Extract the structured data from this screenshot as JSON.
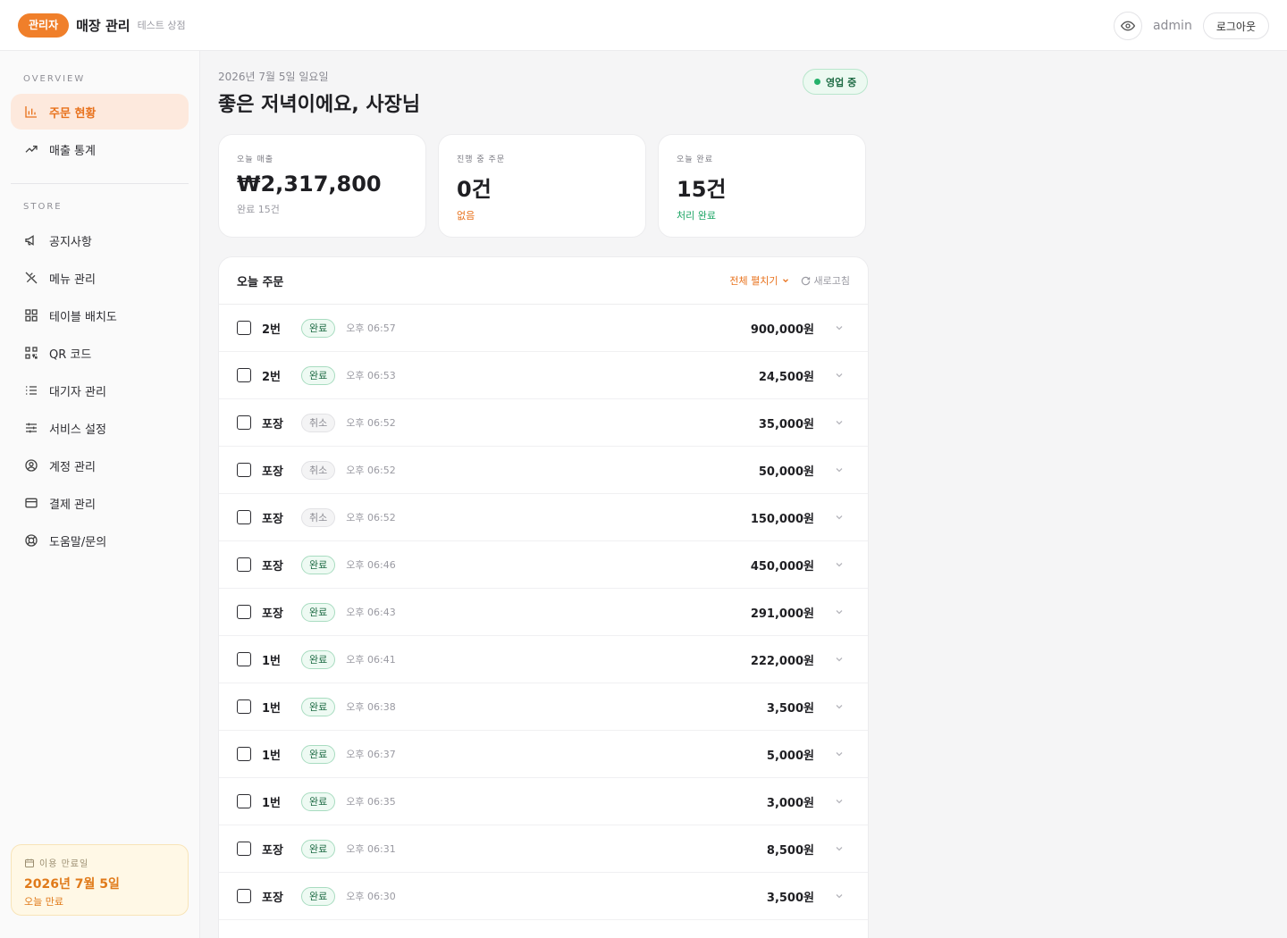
{
  "header": {
    "role_badge": "관리자",
    "title": "매장 관리",
    "store_name": "테스트 상점",
    "user": "admin",
    "logout_label": "로그아웃"
  },
  "sidebar": {
    "sections": [
      {
        "title": "OVERVIEW",
        "items": [
          {
            "label": "주문 현황",
            "icon": "bar-chart-icon",
            "active": true
          },
          {
            "label": "매출 통계",
            "icon": "trend-up-icon",
            "active": false
          }
        ]
      },
      {
        "title": "STORE",
        "items": [
          {
            "label": "공지사항",
            "icon": "megaphone-icon"
          },
          {
            "label": "메뉴 관리",
            "icon": "utensils-icon"
          },
          {
            "label": "테이블 배치도",
            "icon": "grid-icon"
          },
          {
            "label": "QR 코드",
            "icon": "qr-code-icon"
          },
          {
            "label": "대기자 관리",
            "icon": "list-icon"
          },
          {
            "label": "서비스 설정",
            "icon": "sliders-icon"
          },
          {
            "label": "계정 관리",
            "icon": "user-circle-icon"
          },
          {
            "label": "결제 관리",
            "icon": "credit-card-icon"
          },
          {
            "label": "도움말/문의",
            "icon": "lifebuoy-icon"
          }
        ]
      }
    ],
    "expiry": {
      "label": "이용 만료일",
      "date": "2026년 7월 5일",
      "sub": "오늘 만료"
    }
  },
  "main": {
    "date": "2026년 7월 5일 일요일",
    "greeting": "좋은 저녁이에요, 사장님",
    "status_badge": "영업 중",
    "cards": [
      {
        "label": "오늘 매출",
        "value": "₩2,317,800",
        "sub": "완료 15건",
        "sub_color": "#9a9aa2"
      },
      {
        "label": "진행 중 주문",
        "value": "0건",
        "sub": "없음",
        "sub_color": "#e8721d"
      },
      {
        "label": "오늘 완료",
        "value": "15건",
        "sub": "처리 완료",
        "sub_color": "#1aa463"
      }
    ],
    "orders": {
      "title": "오늘 주문",
      "expand_all": "전체 펼치기",
      "refresh": "새로고침",
      "rows": [
        {
          "name": "2번",
          "status": "완료",
          "kind": "done",
          "time": "오후 06:57",
          "amount": "900,000원"
        },
        {
          "name": "2번",
          "status": "완료",
          "kind": "done",
          "time": "오후 06:53",
          "amount": "24,500원"
        },
        {
          "name": "포장",
          "status": "취소",
          "kind": "cancel",
          "time": "오후 06:52",
          "amount": "35,000원"
        },
        {
          "name": "포장",
          "status": "취소",
          "kind": "cancel",
          "time": "오후 06:52",
          "amount": "50,000원"
        },
        {
          "name": "포장",
          "status": "취소",
          "kind": "cancel",
          "time": "오후 06:52",
          "amount": "150,000원"
        },
        {
          "name": "포장",
          "status": "완료",
          "kind": "done",
          "time": "오후 06:46",
          "amount": "450,000원"
        },
        {
          "name": "포장",
          "status": "완료",
          "kind": "done",
          "time": "오후 06:43",
          "amount": "291,000원"
        },
        {
          "name": "1번",
          "status": "완료",
          "kind": "done",
          "time": "오후 06:41",
          "amount": "222,000원"
        },
        {
          "name": "1번",
          "status": "완료",
          "kind": "done",
          "time": "오후 06:38",
          "amount": "3,500원"
        },
        {
          "name": "1번",
          "status": "완료",
          "kind": "done",
          "time": "오후 06:37",
          "amount": "5,000원"
        },
        {
          "name": "1번",
          "status": "완료",
          "kind": "done",
          "time": "오후 06:35",
          "amount": "3,000원"
        },
        {
          "name": "포장",
          "status": "완료",
          "kind": "done",
          "time": "오후 06:31",
          "amount": "8,500원"
        },
        {
          "name": "포장",
          "status": "완료",
          "kind": "done",
          "time": "오후 06:30",
          "amount": "3,500원"
        }
      ]
    }
  },
  "colors": {
    "accent": "#f07f2a",
    "success": "#1aa463",
    "warning_bg": "#fff8e6"
  }
}
